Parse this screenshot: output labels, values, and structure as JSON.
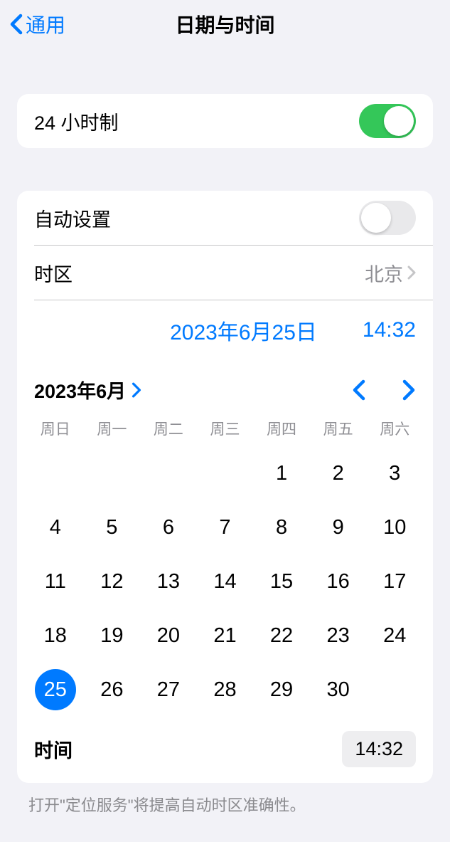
{
  "nav": {
    "back_label": "通用",
    "title": "日期与时间"
  },
  "section1": {
    "clock24_label": "24 小时制",
    "clock24_on": true
  },
  "section2": {
    "auto_set_label": "自动设置",
    "auto_set_on": false,
    "timezone_label": "时区",
    "timezone_value": "北京",
    "selected_date": "2023年6月25日",
    "selected_time": "14:32",
    "calendar": {
      "month_label": "2023年6月",
      "weekdays": [
        "周日",
        "周一",
        "周二",
        "周三",
        "周四",
        "周五",
        "周六"
      ],
      "leading_blanks": 4,
      "days": [
        1,
        2,
        3,
        4,
        5,
        6,
        7,
        8,
        9,
        10,
        11,
        12,
        13,
        14,
        15,
        16,
        17,
        18,
        19,
        20,
        21,
        22,
        23,
        24,
        25,
        26,
        27,
        28,
        29,
        30
      ],
      "selected_day": 25
    },
    "time_label": "时间",
    "time_value": "14:32"
  },
  "footer_note": "打开\"定位服务\"将提高自动时区准确性。"
}
